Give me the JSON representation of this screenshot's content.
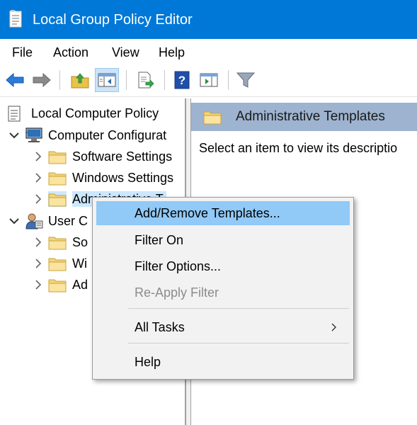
{
  "window": {
    "title": "Local Group Policy Editor",
    "accent": "#0078d7"
  },
  "menu": {
    "items": [
      "File",
      "Action",
      "View",
      "Help"
    ]
  },
  "toolbar": {
    "buttons": [
      "back-arrow-icon",
      "forward-arrow-icon",
      "up-folder-icon",
      "show-hide-tree-icon",
      "export-list-icon",
      "help-icon",
      "show-hide-action-pane-icon",
      "filter-icon"
    ]
  },
  "tree": {
    "root": "Local Computer Policy",
    "computer_config": "Computer Configurat",
    "cc_children": [
      "Software Settings",
      "Windows Settings",
      "Administrative T"
    ],
    "user_config": "User C",
    "uc_children": [
      "So",
      "Wi",
      "Ad"
    ]
  },
  "right_pane": {
    "header": "Administrative Templates",
    "description": "Select an item to view its descriptio"
  },
  "context_menu": {
    "items": [
      {
        "label": "Add/Remove Templates...",
        "state": "highlighted"
      },
      {
        "label": "Filter On",
        "state": "normal"
      },
      {
        "label": "Filter Options...",
        "state": "normal"
      },
      {
        "label": "Re-Apply Filter",
        "state": "disabled"
      },
      {
        "label": "All Tasks",
        "state": "submenu"
      },
      {
        "label": "Help",
        "state": "normal"
      }
    ]
  }
}
